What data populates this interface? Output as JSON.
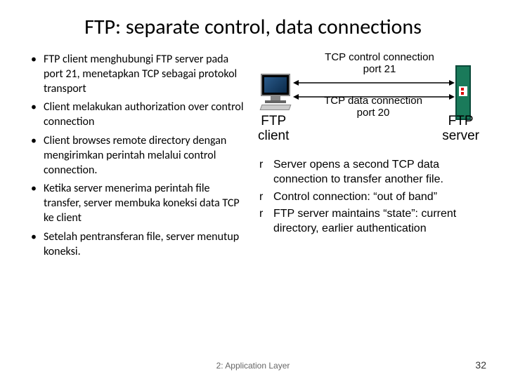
{
  "title": "FTP: separate control, data connections",
  "left_bullets": [
    "FTP client menghubungi FTP server pada port 21, menetapkan TCP sebagai protokol transport",
    "Client melakukan authorization over control connection",
    "Client browses remote directory dengan mengirimkan perintah melalui control connection.",
    "Ketika server menerima perintah file transfer, server membuka koneksi data TCP ke client",
    "Setelah pentransferan file, server menutup koneksi."
  ],
  "diagram": {
    "client_label_line1": "FTP",
    "client_label_line2": "client",
    "server_label_line1": "FTP",
    "server_label_line2": "server",
    "control_label_line1": "TCP control connection",
    "control_label_line2": "port 21",
    "data_label_line1": "TCP data connection",
    "data_label_line2": "port 20"
  },
  "right_bullets": [
    "Server opens a second TCP data connection to transfer another file.",
    "Control connection: “out of band”",
    "FTP server maintains “state”: current directory, earlier authentication"
  ],
  "footer": {
    "section": "2: Application Layer",
    "page": "32"
  }
}
